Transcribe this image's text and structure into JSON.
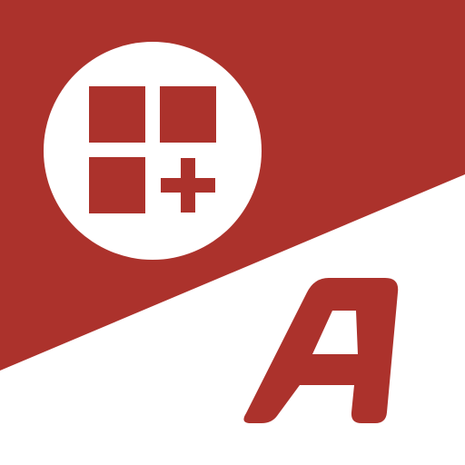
{
  "icon": {
    "name": "app-grid-plus-letter-a-icon",
    "brand_color": "#ac322c",
    "background_color": "#ffffff",
    "badge_glyph": "apps-plus",
    "letter_mark": "A"
  }
}
